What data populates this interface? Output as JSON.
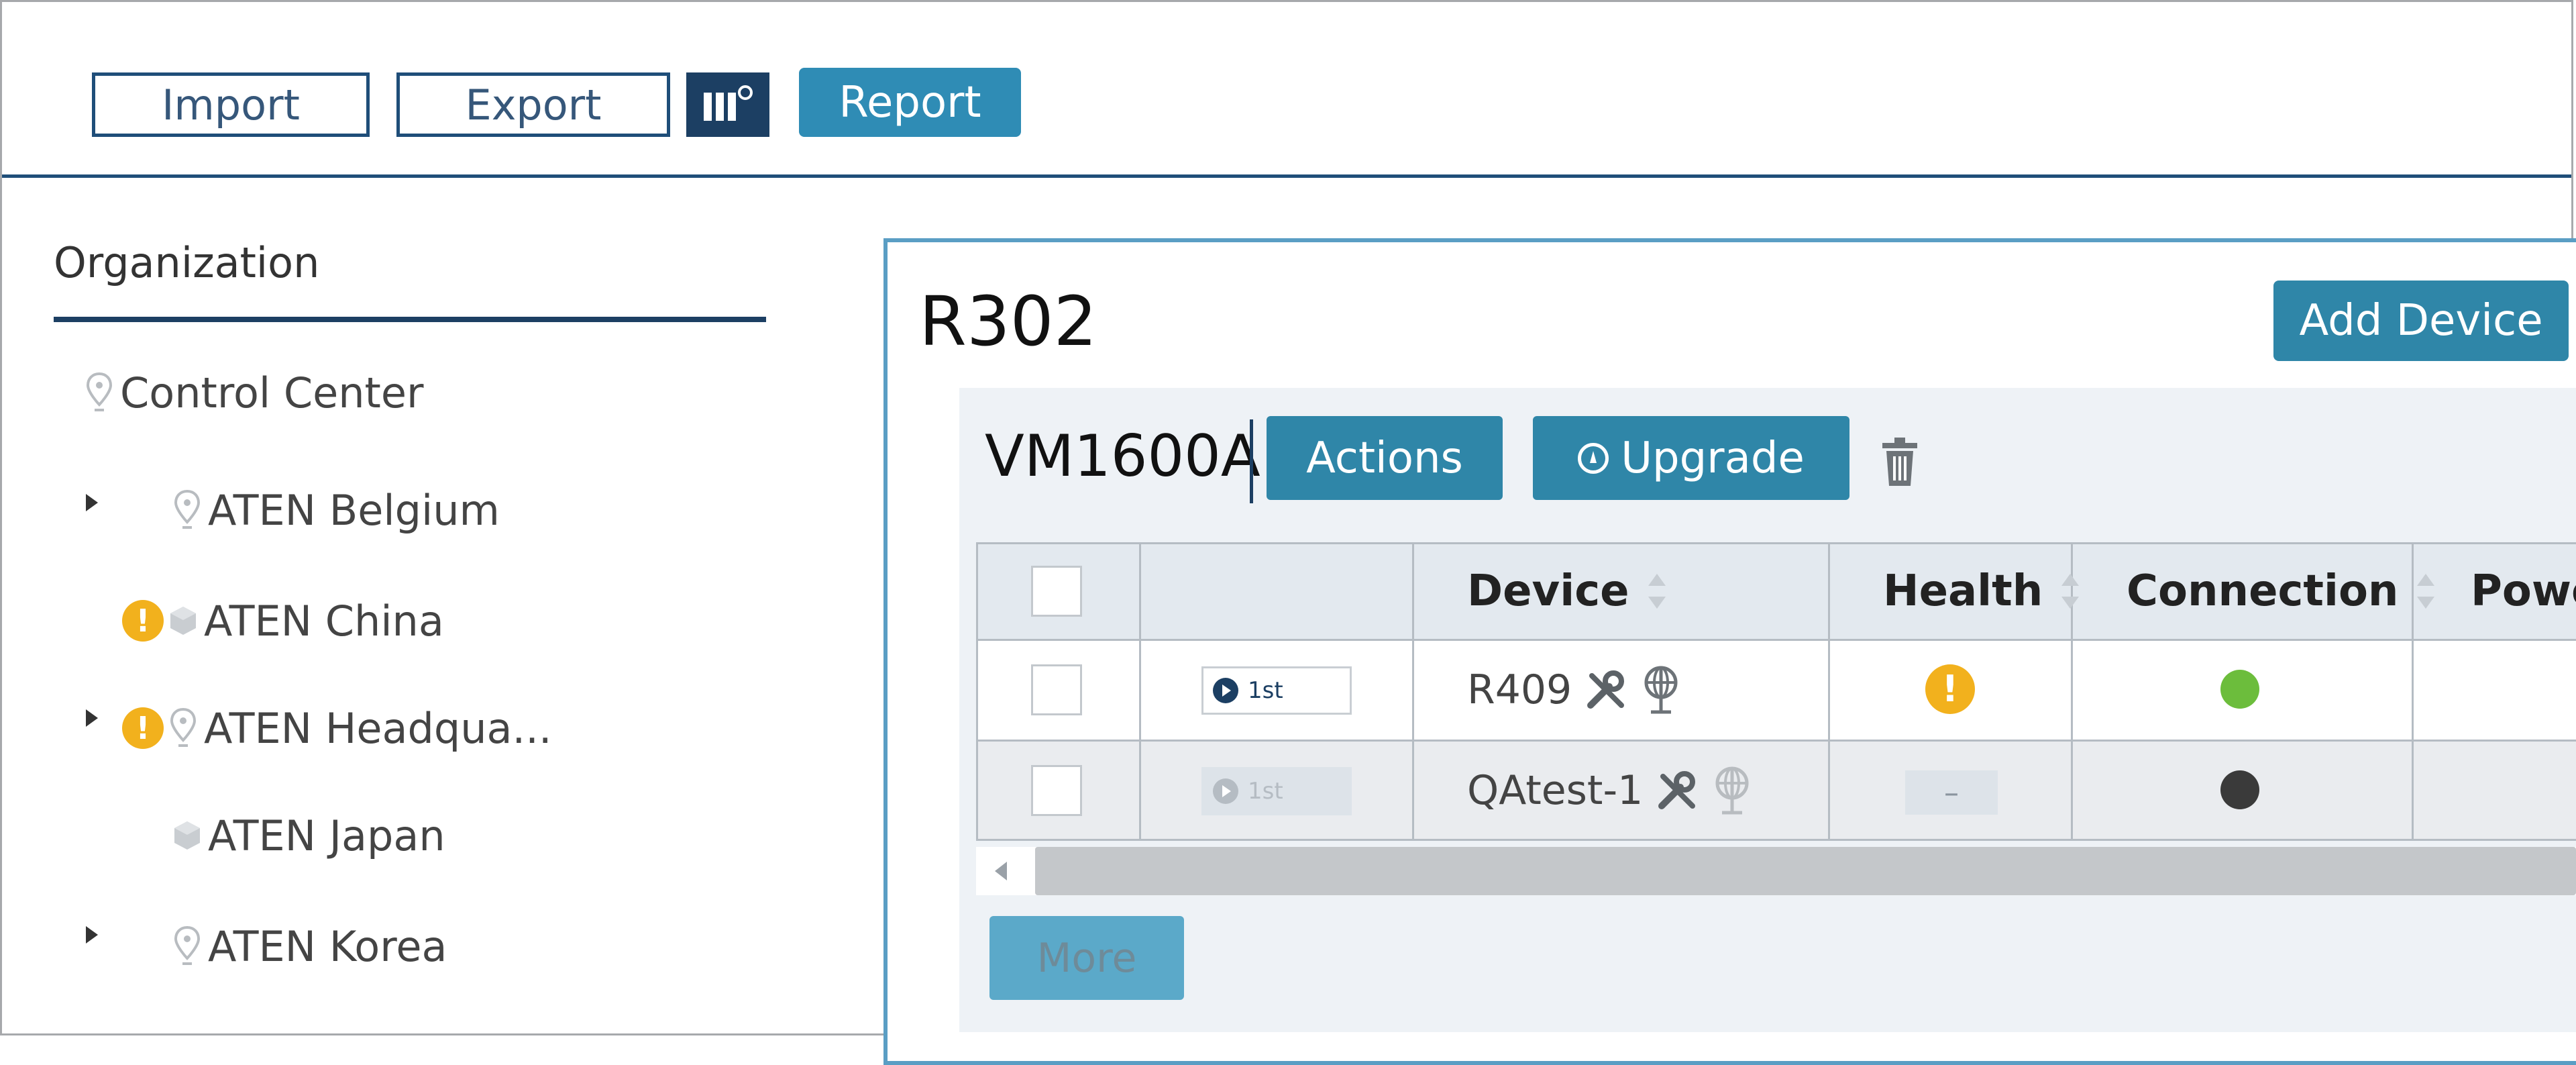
{
  "toolbar": {
    "import_label": "Import",
    "export_label": "Export",
    "columns_icon": "column-settings-icon",
    "report_label": "Report",
    "accent_color": "#1f4e79"
  },
  "sidebar": {
    "title": "Organization",
    "items": [
      {
        "label": "Control Center",
        "icon": "location-pin-icon",
        "expandable": false,
        "warning": false
      },
      {
        "label": "ATEN  Belgium",
        "icon": "location-pin-icon",
        "expandable": true,
        "warning": false
      },
      {
        "label": "ATEN  China",
        "icon": "cube-icon",
        "expandable": false,
        "warning": true
      },
      {
        "label": "ATEN  Headqua...",
        "icon": "location-pin-icon",
        "expandable": true,
        "warning": true
      },
      {
        "label": "ATEN  Japan",
        "icon": "cube-icon",
        "expandable": false,
        "warning": false
      },
      {
        "label": "ATEN  Korea",
        "icon": "location-pin-icon",
        "expandable": true,
        "warning": false
      }
    ]
  },
  "panel": {
    "title": "R302",
    "add_device_label": "Add Device",
    "device_group": {
      "name": "VM1600A",
      "actions_label": "Actions",
      "upgrade_label": "Upgrade",
      "delete_icon": "trash-icon"
    },
    "table": {
      "columns": [
        "Device",
        "Health",
        "Connection",
        "Powe"
      ],
      "rows": [
        {
          "port": "1st",
          "device": "R409",
          "health": "warning",
          "connection": "online",
          "connection_color": "#6cbd3c",
          "dimmed": false
        },
        {
          "port": "1st",
          "device": "QAtest-1",
          "health": "–",
          "connection": "offline",
          "connection_color": "#3a3a3a",
          "dimmed": true
        }
      ],
      "warning_color": "#f2b11d"
    },
    "more_label": "More"
  }
}
